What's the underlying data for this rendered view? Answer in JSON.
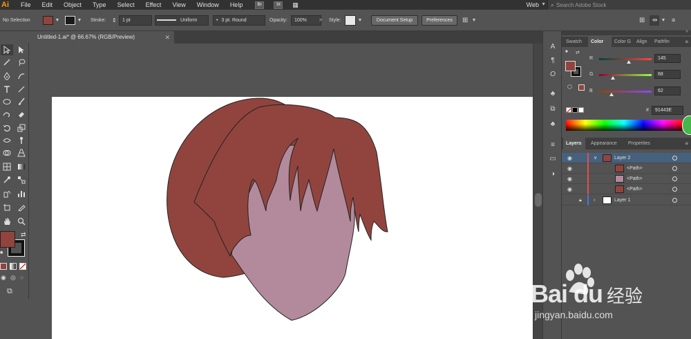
{
  "menubar": {
    "logo": "Ai",
    "items": [
      "File",
      "Edit",
      "Object",
      "Type",
      "Select",
      "Effect",
      "View",
      "Window",
      "Help"
    ],
    "bridge": "Br",
    "stock": "St",
    "workspace": "Web",
    "search_placeholder": "Search Adobe Stock"
  },
  "control": {
    "selection_status": "No Selection",
    "fill_color": "#91443E",
    "stroke_label": "Stroke:",
    "stroke_weight": "1 pt",
    "stroke_profile": "Uniform",
    "brush": "3 pt. Round",
    "opacity_label": "Opacity:",
    "opacity_value": "100%",
    "style_label": "Style:",
    "document_setup": "Document Setup",
    "preferences": "Preferences"
  },
  "document": {
    "tab_title": "Untitled-1.ai* @ 66.67% (RGB/Preview)"
  },
  "colors": {
    "hair": "#91443E",
    "face": "#B38A9B",
    "ui_bg": "#535353"
  },
  "color_panel": {
    "tabs": [
      "Swatch",
      "Color",
      "Color G",
      "Align",
      "Pathfin"
    ],
    "active_tab": "Color",
    "r_label": "R",
    "g_label": "G",
    "b_label": "B",
    "r": 145,
    "g": 68,
    "b": 62,
    "hex_label": "#",
    "hex": "91443E"
  },
  "layers_panel": {
    "tabs": [
      "Layers",
      "Appearance",
      "Properties"
    ],
    "active_tab": "Layers",
    "rows": [
      {
        "name": "Layer 2",
        "level": 0
      },
      {
        "name": "<Path>",
        "level": 1
      },
      {
        "name": "<Path>",
        "level": 1
      },
      {
        "name": "<Path>",
        "level": 1
      },
      {
        "name": "Layer 1",
        "level": 0
      }
    ]
  },
  "watermark": {
    "brand": "Bai du",
    "cn": "经验",
    "url": "jingyan.baidu.com"
  }
}
